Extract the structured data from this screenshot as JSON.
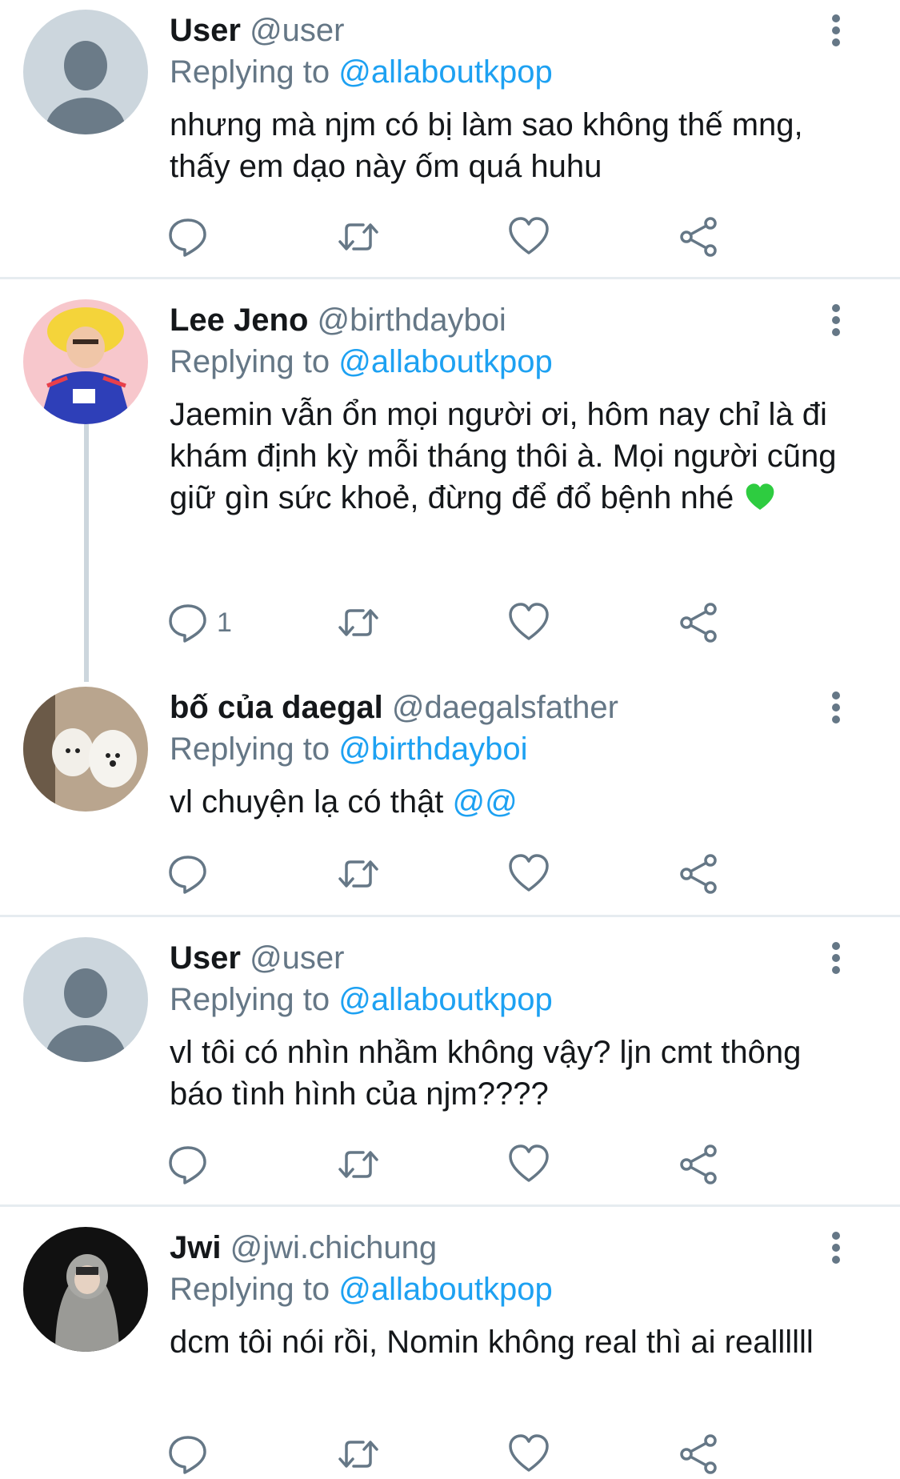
{
  "labels": {
    "replying_to": "Replying to"
  },
  "tweets": [
    {
      "name": "User",
      "handle": "@user",
      "reply_to": "@allaboutkpop",
      "text": "nhưng mà njm có bị làm sao không thế mng, thấy em dạo này ốm quá huhu",
      "reply_count": "",
      "avatar": "default-avatar"
    },
    {
      "name": "Lee Jeno",
      "handle": "@birthdayboi",
      "reply_to": "@allaboutkpop",
      "text": "Jaemin vẫn ổn mọi người ơi, hôm nay chỉ là đi khám định kỳ mỗi tháng thôi à. Mọi người cũng giữ gìn sức khoẻ, đừng để đổ bệnh nhé",
      "emoji": "💚",
      "reply_count": "1",
      "avatar": "yellow-hair-photo"
    },
    {
      "name": "bố của daegal",
      "handle": "@daegalsfather",
      "reply_to": "@birthdayboi",
      "text": "vl chuyện lạ có thật",
      "text_mention": "@@",
      "reply_count": "",
      "avatar": "dogs-photo"
    },
    {
      "name": "User",
      "handle": "@user",
      "reply_to": "@allaboutkpop",
      "text": "vl tôi có nhìn nhầm không vậy? ljn cmt thông báo tình hình của njm????",
      "reply_count": "",
      "avatar": "default-avatar"
    },
    {
      "name": "Jwi",
      "handle": "@jwi.chichung",
      "reply_to": "@allaboutkpop",
      "text": "dcm tôi nói rồi, Nomin không real thì ai reallllll",
      "reply_count": "",
      "avatar": "hoodie-photo"
    }
  ],
  "icons": [
    "more-icon",
    "reply-icon",
    "retweet-icon",
    "like-icon",
    "share-icon"
  ],
  "colors": {
    "link": "#1da1f2",
    "secondary": "#657786",
    "divider": "#e6ecf0",
    "heart": "#2ecc40"
  }
}
